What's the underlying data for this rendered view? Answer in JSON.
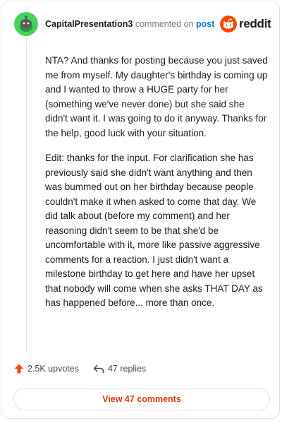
{
  "header": {
    "username": "CapitalPresentation3",
    "action_text": "commented on",
    "post_link": "post",
    "brand": "reddit"
  },
  "comment": {
    "paragraphs": [
      "NTA? And thanks for posting because you just saved me from myself. My daughter's birthday is coming up and I wanted to throw a HUGE party for her (something we've never done) but she said she didn't want it. I was going to do it anyway. Thanks for the help, good luck with your situation.",
      "Edit: thanks for the input. For clarification she has previously said she didn't want anything and then was bummed out on her birthday because people couldn't make it when asked to come that day. We did talk about (before my comment) and her reasoning didn't seem to be that she'd be uncomfortable with it, more like passive aggressive comments for a reaction. I just didn't want a milestone birthday to get here and have her upset that nobody will come when she asks THAT DAY as has happened before... more than once."
    ]
  },
  "actions": {
    "upvotes": "2.5K upvotes",
    "replies": "47 replies"
  },
  "view_comments_label": "View 47 comments",
  "icons": {
    "avatar": "snoo-avatar-icon",
    "logo": "reddit-logo-icon",
    "upvote": "upvote-arrow-icon",
    "reply": "reply-arrow-icon"
  },
  "colors": {
    "upvote": "#ff4500",
    "link": "#0079d3",
    "button_text": "#d93a00",
    "avatar": "#46d160"
  }
}
